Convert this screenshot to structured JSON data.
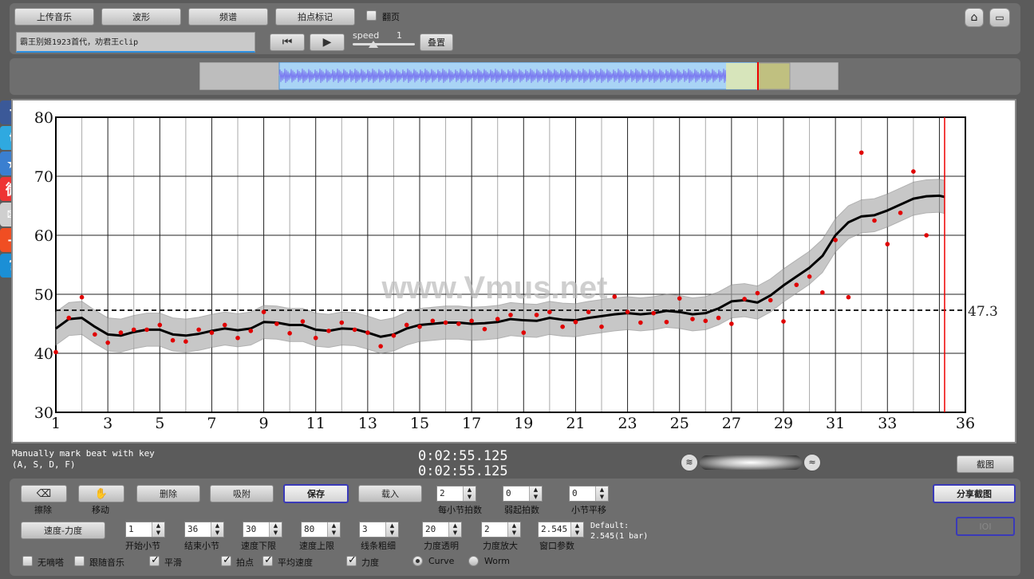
{
  "toolbar": {
    "upload_label": "上传音乐",
    "waveform_label": "波形",
    "spectrum_label": "频谱",
    "beat_mark_label": "拍点标记",
    "page_flip_label": "翻页",
    "filename": "霸王别姬1923首代，劝君王clip",
    "speed_label": "speed",
    "speed_value": "1",
    "overlay_label": "叠置",
    "home_icon": "home-icon",
    "window_icon": "window-icon"
  },
  "social": [
    {
      "name": "facebook-icon",
      "glyph": "f",
      "color": "#3b5998"
    },
    {
      "name": "twitter-icon",
      "glyph": "t",
      "color": "#2fa9e0"
    },
    {
      "name": "favorite-star-icon",
      "glyph": "★",
      "color": "#3a7fd0"
    },
    {
      "name": "weibo-icon",
      "glyph": "微",
      "color": "#e33"
    },
    {
      "name": "mail-icon",
      "glyph": "✉",
      "color": "#cfcfcf"
    },
    {
      "name": "add-share-icon",
      "glyph": "+",
      "color": "#f04e23"
    },
    {
      "name": "help-icon",
      "glyph": "?",
      "color": "#1b8fd6"
    }
  ],
  "chart_data": {
    "type": "line",
    "title": "",
    "xlabel": "",
    "ylabel": "",
    "xlim": [
      1,
      36
    ],
    "ylim": [
      30,
      80
    ],
    "x_ticks": [
      1,
      3,
      5,
      7,
      9,
      11,
      13,
      15,
      17,
      19,
      21,
      23,
      25,
      27,
      29,
      31,
      33,
      36
    ],
    "y_ticks": [
      30,
      40,
      50,
      60,
      70,
      80
    ],
    "grid": true,
    "average_line": 47.3,
    "average_label": "47.3",
    "current_position": 35.2,
    "watermark": "www.Vmus.net",
    "series": [
      {
        "name": "",
        "kind": "smoothed",
        "x": [
          1,
          1.5,
          2,
          2.5,
          3,
          3.5,
          4,
          4.5,
          5,
          5.5,
          6,
          6.5,
          7,
          7.5,
          8,
          8.5,
          9,
          9.5,
          10,
          10.5,
          11,
          11.5,
          12,
          12.5,
          13,
          13.5,
          14,
          14.5,
          15,
          15.5,
          16,
          16.5,
          17,
          17.5,
          18,
          18.5,
          19,
          19.5,
          20,
          20.5,
          21,
          21.5,
          22,
          22.5,
          23,
          23.5,
          24,
          24.5,
          25,
          25.5,
          26,
          26.5,
          27,
          27.5,
          28,
          28.5,
          29,
          29.5,
          30,
          30.5,
          31,
          31.5,
          32,
          32.5,
          33,
          33.5,
          34,
          34.5,
          35,
          35.2
        ],
        "y": [
          44.2,
          45.8,
          46.0,
          44.5,
          43.2,
          43.0,
          43.6,
          44.0,
          44.0,
          43.2,
          43.0,
          43.3,
          43.8,
          44.2,
          43.9,
          44.2,
          45.3,
          45.2,
          44.8,
          44.8,
          44.0,
          43.8,
          44.2,
          44.1,
          43.5,
          42.8,
          43.2,
          44.2,
          44.8,
          45.0,
          45.2,
          45.2,
          45.0,
          45.1,
          45.3,
          45.8,
          45.6,
          45.5,
          46.0,
          45.7,
          45.6,
          46.0,
          46.3,
          46.6,
          46.8,
          46.6,
          46.8,
          47.2,
          47.0,
          46.6,
          46.8,
          47.6,
          48.8,
          49.0,
          48.6,
          49.8,
          51.5,
          53.0,
          54.5,
          56.5,
          60.0,
          62.2,
          63.2,
          63.4,
          64.2,
          65.2,
          66.2,
          66.6,
          66.7,
          66.5
        ],
        "band": 2.8
      },
      {
        "name": "",
        "kind": "raw",
        "x": [
          1,
          1.5,
          2,
          2.5,
          3,
          3.5,
          4,
          4.5,
          5,
          5.5,
          6,
          6.5,
          7,
          7.5,
          8,
          8.5,
          9,
          9.5,
          10,
          10.5,
          11,
          11.5,
          12,
          12.5,
          13,
          13.5,
          14,
          14.5,
          15,
          15.5,
          16,
          16.5,
          17,
          17.5,
          18,
          18.5,
          19,
          19.5,
          20,
          20.5,
          21,
          21.5,
          22,
          22.5,
          23,
          23.5,
          24,
          24.5,
          25,
          25.5,
          26,
          26.5,
          27,
          27.5,
          28,
          28.5,
          29,
          29.5,
          30,
          30.5,
          31,
          31.5,
          32,
          32.5,
          33,
          33.5,
          34,
          34.5
        ],
        "y": [
          40.2,
          46.0,
          49.5,
          43.2,
          41.8,
          43.5,
          44.0,
          44.0,
          44.8,
          42.2,
          42.0,
          44.0,
          43.5,
          44.8,
          42.6,
          43.8,
          47.0,
          45.0,
          43.4,
          45.4,
          42.6,
          43.8,
          45.2,
          44.0,
          43.5,
          41.2,
          43.0,
          44.8,
          44.5,
          45.5,
          45.2,
          45.0,
          45.5,
          44.1,
          45.8,
          46.5,
          43.5,
          46.5,
          47.0,
          44.5,
          45.3,
          47.0,
          44.5,
          49.6,
          47.0,
          45.2,
          46.8,
          45.3,
          49.3,
          45.8,
          45.5,
          46.0,
          45.0,
          49.2,
          50.2,
          49.0,
          45.4,
          51.6,
          53.0,
          50.3,
          59.2,
          49.5,
          74.0,
          62.5,
          58.5,
          63.8,
          70.8,
          60.0
        ],
        "color": "#e00000"
      }
    ]
  },
  "status": {
    "hint_line1": "Manually mark beat with key",
    "hint_line2": "(A, S, D, F)",
    "time1": "0:02:55.125",
    "time2": "0:02:55.125",
    "screenshot_label": "截图"
  },
  "controls": {
    "eraser_label": "擦除",
    "move_label": "移动",
    "delete_label": "删除",
    "snap_label": "吸附",
    "save_label": "保存",
    "load_label": "载入",
    "beats_per_bar_value": "2",
    "beats_per_bar_label": "每小节拍数",
    "pickup_value": "0",
    "pickup_label": "弱起拍数",
    "bar_shift_value": "0",
    "bar_shift_label": "小节平移",
    "share_screenshot_label": "分享截图",
    "ioi_label": "IOI",
    "tempo_dynamics_label": "速度-力度",
    "start_bar_value": "1",
    "start_bar_label": "开始小节",
    "end_bar_value": "36",
    "end_bar_label": "结束小节",
    "tempo_min_value": "30",
    "tempo_min_label": "速度下限",
    "tempo_max_value": "80",
    "tempo_max_label": "速度上限",
    "line_width_value": "3",
    "line_width_label": "线条粗细",
    "dyn_transparency_value": "20",
    "dyn_transparency_label": "力度透明",
    "dyn_scale_value": "2",
    "dyn_scale_label": "力度放大",
    "window_value": "2.545",
    "window_label": "窗口参数",
    "default_line1": "Default:",
    "default_line2": "2.545(1 bar)",
    "no_click_label": "无嘀嗒",
    "follow_music_label": "跟随音乐",
    "smooth_label": "平滑",
    "beats_label": "拍点",
    "avg_tempo_label": "平均速度",
    "dynamics_label": "力度",
    "curve_label": "Curve",
    "worm_label": "Worm"
  }
}
